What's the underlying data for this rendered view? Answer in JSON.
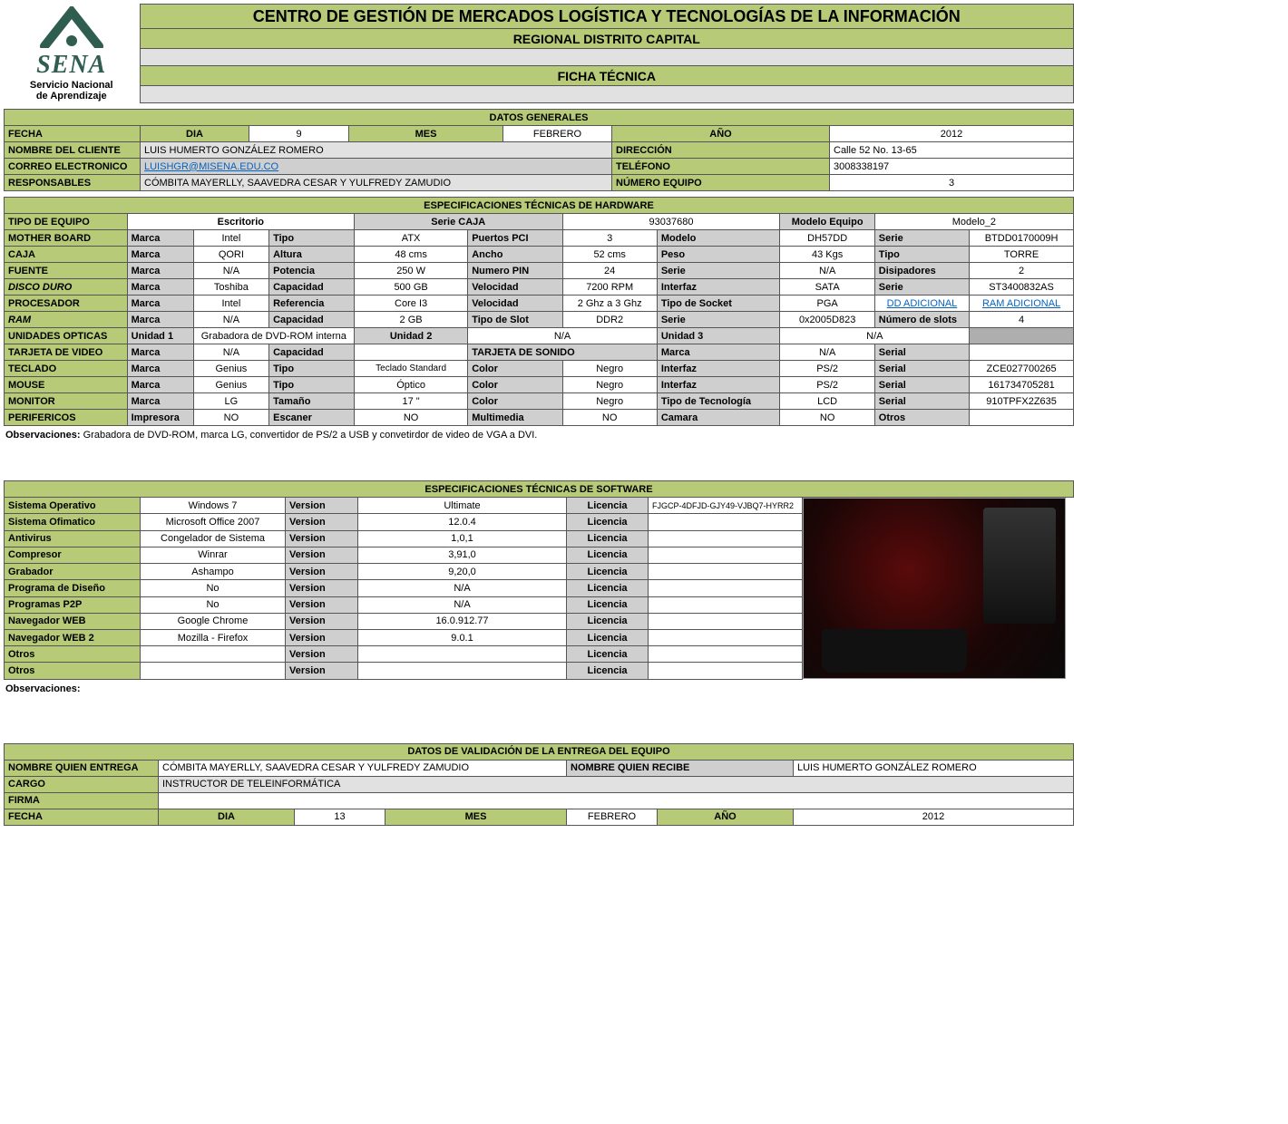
{
  "header": {
    "title": "CENTRO DE GESTIÓN DE MERCADOS LOGÍSTICA Y TECNOLOGÍAS DE LA INFORMACIÓN",
    "subtitle": "REGIONAL DISTRITO CAPITAL",
    "ficha": "FICHA TÉCNICA",
    "logo_brand": "SENA",
    "logo_sub1": "Servicio Nacional",
    "logo_sub2": "de Aprendizaje"
  },
  "datos_generales": {
    "section": "DATOS GENERALES",
    "fecha_lbl": "FECHA",
    "dia_lbl": "DIA",
    "dia": "9",
    "mes_lbl": "MES",
    "mes": "FEBRERO",
    "ano_lbl": "AÑO",
    "ano": "2012",
    "cliente_lbl": "NOMBRE DEL CLIENTE",
    "cliente": "LUIS HUMERTO GONZÁLEZ ROMERO",
    "dir_lbl": "DIRECCIÓN",
    "dir": "Calle 52  No. 13-65",
    "correo_lbl": "CORREO ELECTRONICO",
    "correo": "LUISHGR@MISENA.EDU.CO",
    "tel_lbl": "TELÉFONO",
    "tel": "3008338197",
    "resp_lbl": "RESPONSABLES",
    "resp": "CÓMBITA MAYERLLY,  SAAVEDRA  CESAR  Y YULFREDY ZAMUDIO",
    "neq_lbl": "NÚMERO EQUIPO",
    "neq": "3"
  },
  "hw": {
    "section": "ESPECIFICACIONES TÉCNICAS DE HARDWARE",
    "tipo_eq_lbl": "TIPO DE EQUIPO",
    "tipo_eq": "Escritorio",
    "serie_caja_lbl": "Serie CAJA",
    "serie_caja": "93037680",
    "modelo_eq_lbl": "Modelo Equipo",
    "modelo_eq": "Modelo_2",
    "mb_lbl": "MOTHER BOARD",
    "marca_lbl": "Marca",
    "mb_marca": "Intel",
    "tipo_lbl": "Tipo",
    "mb_tipo": "ATX",
    "pci_lbl": "Puertos PCI",
    "mb_pci": "3",
    "modelo_lbl": "Modelo",
    "mb_modelo": "DH57DD",
    "serie_lbl": "Serie",
    "mb_serie": "BTDD0170009H",
    "caja_lbl": "CAJA",
    "caja_marca": "QORI",
    "altura_lbl": "Altura",
    "caja_alt": "48 cms",
    "ancho_lbl": "Ancho",
    "caja_ancho": "52 cms",
    "peso_lbl": "Peso",
    "caja_peso": "43 Kgs",
    "caja_tipo": "TORRE",
    "fuente_lbl": "FUENTE",
    "fuente_marca": "N/A",
    "pot_lbl": "Potencia",
    "fuente_pot": "250 W",
    "pin_lbl": "Numero PIN",
    "fuente_pin": "24",
    "fuente_serie": "N/A",
    "disip_lbl": "Disipadores",
    "fuente_disip": "2",
    "dd_lbl": "DISCO DURO",
    "dd_marca": "Toshiba",
    "cap_lbl": "Capacidad",
    "dd_cap": "500 GB",
    "vel_lbl": "Velocidad",
    "dd_vel": "7200 RPM",
    "intf_lbl": "Interfaz",
    "dd_intf": "SATA",
    "dd_serie": "ST3400832AS",
    "cpu_lbl": "PROCESADOR",
    "cpu_marca": "Intel",
    "ref_lbl": "Referencia",
    "cpu_ref": "Core I3",
    "cpu_vel": "2 Ghz a 3 Ghz",
    "sock_lbl": "Tipo de Socket",
    "cpu_sock": "PGA",
    "dd_add": "DD ADICIONAL",
    "ram_add": "RAM ADICIONAL",
    "ram_lbl": "RAM",
    "ram_marca": "N/A",
    "ram_cap": "2 GB",
    "slot_lbl": "Tipo de Slot",
    "ram_slot": "DDR2",
    "ram_serie": "0x2005D823",
    "nslots_lbl": "Número de slots",
    "ram_nslots": "4",
    "opt_lbl": "UNIDADES OPTICAS",
    "u1_lbl": "Unidad 1",
    "u1": "Grabadora de DVD-ROM interna",
    "u2_lbl": "Unidad 2",
    "u2": "N/A",
    "u3_lbl": "Unidad 3",
    "u3": "N/A",
    "tv_lbl": "TARJETA DE VIDEO",
    "tv_marca": "N/A",
    "tv_cap": "",
    "ts_lbl": "TARJETA DE SONIDO",
    "ts_marca_lbl": "Marca",
    "ts_marca": "N/A",
    "serial_lbl": "Serial",
    "ts_serial": "",
    "tec_lbl": "TECLADO",
    "tec_marca": "Genius",
    "tec_tipo": "Teclado Standard",
    "color_lbl": "Color",
    "tec_color": "Negro",
    "tec_intf": "PS/2",
    "tec_serial": "ZCE027700265",
    "mouse_lbl": "MOUSE",
    "mouse_marca": "Genius",
    "mouse_tipo": "Óptico",
    "mouse_color": "Negro",
    "mouse_intf": "PS/2",
    "mouse_serial": "161734705281",
    "mon_lbl": "MONITOR",
    "mon_marca": "LG",
    "tam_lbl": "Tamaño",
    "mon_tam": "17 \"",
    "mon_color": "Negro",
    "tech_lbl": "Tipo de Tecnología",
    "mon_tech": "LCD",
    "mon_serial": "910TPFX2Z635",
    "per_lbl": "PERIFERICOS",
    "imp_lbl": "Impresora",
    "per_imp": "NO",
    "esc_lbl": "Escaner",
    "per_esc": "NO",
    "mm_lbl": "Multimedia",
    "per_mm": "NO",
    "cam_lbl": "Camara",
    "per_cam": "NO",
    "otros_lbl": "Otros",
    "per_otros": "",
    "obs_lbl": "Observaciones:",
    "obs": "Grabadora de DVD-ROM, marca LG, convertidor de PS/2 a USB y convetirdor de video de VGA a DVI."
  },
  "sw": {
    "section": "ESPECIFICACIONES TÉCNICAS DE SOFTWARE",
    "ver_lbl": "Version",
    "lic_lbl": "Licencia",
    "rows": [
      {
        "lbl": "Sistema Operativo",
        "name": "Windows 7",
        "ver": "Ultimate",
        "lic": "FJGCP-4DFJD-GJY49-VJBQ7-HYRR2"
      },
      {
        "lbl": "Sistema Ofimatico",
        "name": "Microsoft Office 2007",
        "ver": "12.0.4",
        "lic": ""
      },
      {
        "lbl": "Antivirus",
        "name": "Congelador de Sistema",
        "ver": "1,0,1",
        "lic": ""
      },
      {
        "lbl": "Compresor",
        "name": "Winrar",
        "ver": "3,91,0",
        "lic": ""
      },
      {
        "lbl": "Grabador",
        "name": "Ashampo",
        "ver": "9,20,0",
        "lic": ""
      },
      {
        "lbl": "Programa de Diseño",
        "name": "No",
        "ver": "N/A",
        "lic": ""
      },
      {
        "lbl": "Programas P2P",
        "name": "No",
        "ver": "N/A",
        "lic": ""
      },
      {
        "lbl": "Navegador WEB",
        "name": "Google Chrome",
        "ver": "16.0.912.77",
        "lic": ""
      },
      {
        "lbl": "Navegador WEB 2",
        "name": "Mozilla - Firefox",
        "ver": "9.0.1",
        "lic": ""
      },
      {
        "lbl": "Otros",
        "name": "",
        "ver": "",
        "lic": ""
      },
      {
        "lbl": "Otros",
        "name": "",
        "ver": "",
        "lic": ""
      }
    ],
    "obs_lbl": "Observaciones:"
  },
  "val": {
    "section": "DATOS DE VALIDACIÓN DE LA ENTREGA DEL EQUIPO",
    "entrega_lbl": "NOMBRE QUIEN ENTREGA",
    "entrega": "CÓMBITA MAYERLLY,  SAAVEDRA  CESAR  Y YULFREDY ZAMUDIO",
    "recibe_lbl": "NOMBRE QUIEN RECIBE",
    "recibe": "LUIS HUMERTO GONZÁLEZ ROMERO",
    "cargo_lbl": "CARGO",
    "cargo": "INSTRUCTOR DE TELEINFORMÁTICA",
    "firma_lbl": "FIRMA",
    "fecha_lbl": "FECHA",
    "dia_lbl": "DIA",
    "dia": "13",
    "mes_lbl": "MES",
    "mes": "FEBRERO",
    "ano_lbl": "AÑO",
    "ano": "2012"
  }
}
